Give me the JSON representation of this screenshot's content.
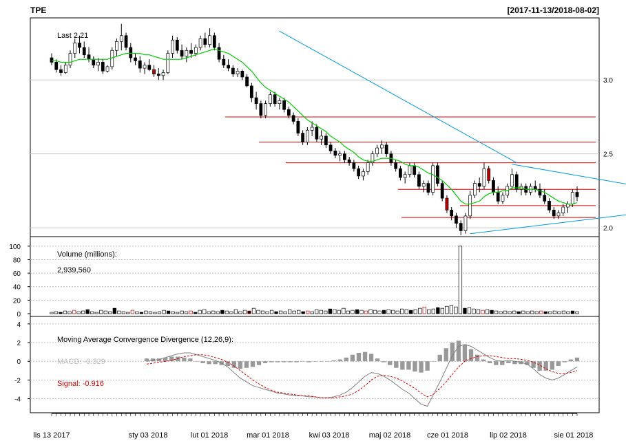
{
  "header": {
    "symbol": "TPE",
    "date_range": "[2017-11-13/2018-08-02]"
  },
  "chart_data": [
    {
      "type": "candlestick",
      "panel": "price",
      "label": "Last 2.21",
      "y_ticks": [
        "3.0",
        "2.5",
        "2.0"
      ],
      "ylim": [
        1.94,
        3.42
      ],
      "grid": true,
      "ohlc": [
        [
          3.15,
          3.18,
          3.1,
          3.12
        ],
        [
          3.12,
          3.14,
          3.05,
          3.07
        ],
        [
          3.07,
          3.1,
          3.03,
          3.05
        ],
        [
          3.05,
          3.12,
          3.04,
          3.1
        ],
        [
          3.1,
          3.2,
          3.08,
          3.18
        ],
        [
          3.18,
          3.28,
          3.15,
          3.25
        ],
        [
          3.25,
          3.3,
          3.18,
          3.22
        ],
        [
          3.22,
          3.26,
          3.15,
          3.17
        ],
        [
          3.17,
          3.22,
          3.12,
          3.14
        ],
        [
          3.14,
          3.16,
          3.08,
          3.1
        ],
        [
          3.1,
          3.15,
          3.06,
          3.12
        ],
        [
          3.12,
          3.14,
          3.04,
          3.06
        ],
        [
          3.06,
          3.1,
          3.05,
          3.09
        ],
        [
          3.09,
          3.22,
          3.07,
          3.2
        ],
        [
          3.2,
          3.28,
          3.16,
          3.26
        ],
        [
          3.26,
          3.38,
          3.2,
          3.3
        ],
        [
          3.3,
          3.32,
          3.2,
          3.22
        ],
        [
          3.22,
          3.25,
          3.12,
          3.15
        ],
        [
          3.15,
          3.18,
          3.1,
          3.13
        ],
        [
          3.13,
          3.16,
          3.05,
          3.08
        ],
        [
          3.08,
          3.12,
          3.04,
          3.1
        ],
        [
          3.1,
          3.14,
          3.06,
          3.07
        ],
        [
          3.07,
          3.1,
          3.02,
          3.04
        ],
        [
          3.04,
          3.08,
          3.0,
          3.03
        ],
        [
          3.03,
          3.07,
          3.0,
          3.05
        ],
        [
          3.05,
          3.2,
          3.04,
          3.18
        ],
        [
          3.18,
          3.3,
          3.15,
          3.27
        ],
        [
          3.27,
          3.29,
          3.18,
          3.2
        ],
        [
          3.2,
          3.24,
          3.14,
          3.16
        ],
        [
          3.16,
          3.22,
          3.12,
          3.2
        ],
        [
          3.2,
          3.25,
          3.15,
          3.18
        ],
        [
          3.18,
          3.24,
          3.16,
          3.22
        ],
        [
          3.22,
          3.3,
          3.2,
          3.28
        ],
        [
          3.28,
          3.32,
          3.22,
          3.24
        ],
        [
          3.24,
          3.35,
          3.22,
          3.3
        ],
        [
          3.3,
          3.32,
          3.2,
          3.22
        ],
        [
          3.22,
          3.25,
          3.12,
          3.14
        ],
        [
          3.14,
          3.17,
          3.08,
          3.1
        ],
        [
          3.1,
          3.14,
          3.06,
          3.08
        ],
        [
          3.08,
          3.1,
          3.02,
          3.04
        ],
        [
          3.04,
          3.08,
          3.02,
          3.06
        ],
        [
          3.06,
          3.07,
          3.0,
          3.02
        ],
        [
          3.02,
          3.04,
          2.95,
          2.96
        ],
        [
          2.96,
          2.98,
          2.85,
          2.88
        ],
        [
          2.88,
          2.92,
          2.8,
          2.84
        ],
        [
          2.84,
          2.86,
          2.74,
          2.76
        ],
        [
          2.76,
          2.86,
          2.74,
          2.84
        ],
        [
          2.84,
          2.92,
          2.82,
          2.9
        ],
        [
          2.9,
          2.92,
          2.82,
          2.84
        ],
        [
          2.84,
          2.88,
          2.8,
          2.86
        ],
        [
          2.86,
          2.88,
          2.78,
          2.8
        ],
        [
          2.8,
          2.82,
          2.74,
          2.76
        ],
        [
          2.76,
          2.78,
          2.7,
          2.72
        ],
        [
          2.72,
          2.74,
          2.62,
          2.64
        ],
        [
          2.64,
          2.66,
          2.56,
          2.58
        ],
        [
          2.58,
          2.68,
          2.56,
          2.66
        ],
        [
          2.66,
          2.72,
          2.62,
          2.68
        ],
        [
          2.68,
          2.7,
          2.58,
          2.6
        ],
        [
          2.6,
          2.66,
          2.56,
          2.62
        ],
        [
          2.62,
          2.64,
          2.54,
          2.56
        ],
        [
          2.56,
          2.58,
          2.5,
          2.52
        ],
        [
          2.52,
          2.54,
          2.47,
          2.49
        ],
        [
          2.49,
          2.52,
          2.45,
          2.5
        ],
        [
          2.5,
          2.52,
          2.44,
          2.46
        ],
        [
          2.46,
          2.48,
          2.42,
          2.44
        ],
        [
          2.44,
          2.46,
          2.38,
          2.4
        ],
        [
          2.4,
          2.42,
          2.33,
          2.35
        ],
        [
          2.35,
          2.4,
          2.32,
          2.38
        ],
        [
          2.38,
          2.46,
          2.36,
          2.44
        ],
        [
          2.44,
          2.52,
          2.42,
          2.5
        ],
        [
          2.5,
          2.56,
          2.48,
          2.54
        ],
        [
          2.54,
          2.59,
          2.5,
          2.56
        ],
        [
          2.56,
          2.58,
          2.48,
          2.5
        ],
        [
          2.5,
          2.52,
          2.42,
          2.44
        ],
        [
          2.44,
          2.46,
          2.38,
          2.4
        ],
        [
          2.4,
          2.42,
          2.32,
          2.34
        ],
        [
          2.34,
          2.38,
          2.3,
          2.36
        ],
        [
          2.36,
          2.44,
          2.34,
          2.42
        ],
        [
          2.42,
          2.44,
          2.34,
          2.36
        ],
        [
          2.36,
          2.38,
          2.26,
          2.28
        ],
        [
          2.28,
          2.32,
          2.24,
          2.3
        ],
        [
          2.3,
          2.32,
          2.22,
          2.24
        ],
        [
          2.24,
          2.44,
          2.22,
          2.42
        ],
        [
          2.42,
          2.44,
          2.28,
          2.3
        ],
        [
          2.3,
          2.32,
          2.18,
          2.2
        ],
        [
          2.2,
          2.22,
          2.1,
          2.12
        ],
        [
          2.12,
          2.14,
          2.05,
          2.08
        ],
        [
          2.08,
          2.1,
          2.0,
          2.03
        ],
        [
          2.03,
          2.05,
          1.95,
          1.98
        ],
        [
          1.98,
          2.1,
          1.96,
          2.08
        ],
        [
          2.08,
          2.25,
          2.06,
          2.22
        ],
        [
          2.22,
          2.32,
          2.2,
          2.3
        ],
        [
          2.3,
          2.34,
          2.24,
          2.28
        ],
        [
          2.28,
          2.44,
          2.26,
          2.4
        ],
        [
          2.4,
          2.42,
          2.3,
          2.32
        ],
        [
          2.32,
          2.34,
          2.22,
          2.24
        ],
        [
          2.24,
          2.28,
          2.16,
          2.18
        ],
        [
          2.18,
          2.24,
          2.16,
          2.22
        ],
        [
          2.22,
          2.3,
          2.2,
          2.28
        ],
        [
          2.28,
          2.4,
          2.26,
          2.36
        ],
        [
          2.36,
          2.38,
          2.24,
          2.26
        ],
        [
          2.26,
          2.3,
          2.22,
          2.28
        ],
        [
          2.28,
          2.3,
          2.22,
          2.24
        ],
        [
          2.24,
          2.3,
          2.22,
          2.28
        ],
        [
          2.28,
          2.32,
          2.24,
          2.26
        ],
        [
          2.26,
          2.3,
          2.2,
          2.22
        ],
        [
          2.22,
          2.26,
          2.16,
          2.18
        ],
        [
          2.18,
          2.2,
          2.1,
          2.12
        ],
        [
          2.12,
          2.14,
          2.06,
          2.08
        ],
        [
          2.08,
          2.12,
          2.06,
          2.1
        ],
        [
          2.1,
          2.16,
          2.08,
          2.14
        ],
        [
          2.14,
          2.18,
          2.1,
          2.16
        ],
        [
          2.16,
          2.26,
          2.14,
          2.24
        ],
        [
          2.24,
          2.28,
          2.18,
          2.21
        ]
      ],
      "down_color": "#bb0000",
      "sma": [
        3.13,
        3.13,
        3.12,
        3.12,
        3.12,
        3.13,
        3.14,
        3.14,
        3.14,
        3.14,
        3.14,
        3.14,
        3.14,
        3.15,
        3.16,
        3.17,
        3.18,
        3.18,
        3.18,
        3.18,
        3.17,
        3.17,
        3.16,
        3.15,
        3.14,
        3.14,
        3.14,
        3.14,
        3.14,
        3.15,
        3.16,
        3.17,
        3.18,
        3.19,
        3.2,
        3.21,
        3.2,
        3.19,
        3.18,
        3.16,
        3.14,
        3.12,
        3.09,
        3.06,
        3.02,
        2.98,
        2.95,
        2.93,
        2.91,
        2.89,
        2.87,
        2.85,
        2.82,
        2.79,
        2.76,
        2.73,
        2.71,
        2.69,
        2.67,
        2.65,
        2.62,
        2.6,
        2.58,
        2.55,
        2.53,
        2.51,
        2.48,
        2.46,
        2.45,
        2.45,
        2.46,
        2.47,
        2.47,
        2.47,
        2.46,
        2.45,
        2.43,
        2.42,
        2.42,
        2.41,
        2.39,
        2.37,
        2.36,
        2.34,
        2.32,
        2.29,
        2.26,
        2.22,
        2.18,
        2.16,
        2.16,
        2.17,
        2.18,
        2.21,
        2.23,
        2.24,
        2.24,
        2.25,
        2.25,
        2.27,
        2.27,
        2.27,
        2.26,
        2.26,
        2.26,
        2.25,
        2.24,
        2.22,
        2.2,
        2.18,
        2.17,
        2.16,
        2.16,
        2.17
      ],
      "sma_color": "#00cc00",
      "red_levels": [
        2.75,
        2.58,
        2.44,
        2.26,
        2.15,
        2.07
      ],
      "trendlines": [
        {
          "x1": 49,
          "y1": 3.33,
          "x2": 100,
          "y2": 2.44
        },
        {
          "x1": 99,
          "y1": 2.43,
          "x2": 132,
          "y2": 2.25
        },
        {
          "x1": 90,
          "y1": 1.96,
          "x2": 132,
          "y2": 2.12
        }
      ],
      "trend_color": "#0099dd",
      "level_color": "#dd0000"
    },
    {
      "type": "bar",
      "panel": "volume",
      "label": "Volume (millions):",
      "value_text": "2,939,560",
      "y_ticks": [
        "100",
        "80",
        "60",
        "40",
        "20",
        "0"
      ],
      "ylim": [
        0,
        110
      ],
      "values": [
        2,
        3,
        2,
        4,
        3,
        5,
        3,
        4,
        6,
        3,
        2,
        5,
        4,
        3,
        8,
        4,
        3,
        2,
        5,
        3,
        2,
        4,
        3,
        2,
        3,
        5,
        4,
        3,
        2,
        4,
        3,
        4,
        2,
        5,
        6,
        3,
        4,
        3,
        5,
        4,
        3,
        6,
        3,
        5,
        4,
        8,
        5,
        4,
        3,
        5,
        3,
        4,
        3,
        6,
        4,
        5,
        3,
        4,
        3,
        6,
        5,
        4,
        7,
        6,
        5,
        8,
        4,
        5,
        6,
        5,
        4,
        6,
        5,
        4,
        5,
        6,
        5,
        4,
        7,
        6,
        5,
        6,
        8,
        10,
        6,
        7,
        9,
        8,
        11,
        12,
        10,
        100,
        8,
        9,
        7,
        6,
        5,
        6,
        5,
        4,
        3,
        4,
        3,
        4,
        3,
        4,
        3,
        4,
        3,
        4,
        3,
        3,
        4,
        3,
        4,
        3,
        4,
        3
      ]
    },
    {
      "type": "line",
      "panel": "macd",
      "label": "Moving Average Convergence Divergence (12,26,9):",
      "macd_text": "MACD: -0.329",
      "signal_text": "Signal: -0.916",
      "y_ticks": [
        "4",
        "2",
        "0",
        "-2",
        "-4"
      ],
      "ylim": [
        -5.5,
        4.8
      ],
      "macd": [
        0.0,
        0.1,
        0.2,
        0.4,
        0.6,
        0.8,
        0.9,
        0.9,
        0.7,
        0.5,
        0.3,
        0.1,
        -0.2,
        -0.6,
        -1.2,
        -1.8,
        -2.2,
        -2.6,
        -2.8,
        -3.0,
        -3.2,
        -3.4,
        -3.5,
        -3.6,
        -3.7,
        -3.7,
        -3.8,
        -3.8,
        -3.9,
        -3.9,
        -3.8,
        -3.6,
        -3.3,
        -2.8,
        -2.2,
        -1.6,
        -1.2,
        -1.3,
        -1.6,
        -2.0,
        -2.5,
        -3.0,
        -3.4,
        -4.0,
        -4.6,
        -4.8,
        -3.5,
        -2.2,
        -0.8,
        0.6,
        1.6,
        1.8,
        1.6,
        1.2,
        0.8,
        0.4,
        0.1,
        0.0,
        0.1,
        0.0,
        -0.1,
        -0.3,
        -0.8,
        -1.4,
        -1.8,
        -2.0,
        -1.8,
        -1.4,
        -1.0,
        -0.6
      ],
      "signal": [
        -0.3,
        -0.2,
        -0.1,
        0.0,
        0.1,
        0.3,
        0.5,
        0.6,
        0.7,
        0.7,
        0.6,
        0.4,
        0.2,
        -0.1,
        -0.5,
        -1.0,
        -1.5,
        -2.0,
        -2.4,
        -2.8,
        -3.1,
        -3.3,
        -3.4,
        -3.5,
        -3.6,
        -3.7,
        -3.7,
        -3.8,
        -3.9,
        -3.9,
        -3.9,
        -3.8,
        -3.7,
        -3.5,
        -3.1,
        -2.6,
        -2.0,
        -1.6,
        -1.5,
        -1.6,
        -1.8,
        -2.1,
        -2.5,
        -2.9,
        -3.4,
        -3.8,
        -3.5,
        -2.9,
        -2.2,
        -1.4,
        -0.6,
        0.0,
        0.3,
        0.5,
        0.6,
        0.6,
        0.5,
        0.4,
        0.3,
        0.3,
        0.2,
        0.1,
        -0.1,
        -0.4,
        -0.8,
        -1.1,
        -1.3,
        -1.3,
        -1.2,
        -1.0
      ],
      "histogram": [
        0.3,
        0.3,
        0.3,
        0.4,
        0.5,
        0.5,
        0.4,
        0.3,
        0.0,
        -0.2,
        -0.3,
        -0.3,
        -0.4,
        -0.5,
        -0.7,
        -0.8,
        -0.7,
        -0.6,
        -0.4,
        -0.2,
        -0.1,
        -0.1,
        -0.1,
        -0.1,
        -0.1,
        0.0,
        -0.1,
        0.0,
        0.0,
        0.0,
        0.1,
        0.2,
        0.4,
        0.7,
        0.9,
        1.0,
        0.8,
        0.3,
        -0.1,
        -0.4,
        -0.7,
        -0.9,
        -0.9,
        -1.1,
        -1.2,
        -1.0,
        0.0,
        0.7,
        1.4,
        2.0,
        2.2,
        1.8,
        1.3,
        0.7,
        0.2,
        -0.2,
        -0.4,
        -0.4,
        -0.2,
        -0.3,
        -0.3,
        -0.4,
        -0.7,
        -1.0,
        -1.0,
        -0.9,
        -0.5,
        -0.1,
        0.2,
        0.4
      ],
      "macd_color": "#7f7f7f",
      "signal_color": "#dd0000"
    }
  ],
  "x_labels": [
    "lis 13 2017",
    "sty 03 2018",
    "lut 01 2018",
    "mar 01 2018",
    "kwi 03 2018",
    "maj 02 2018",
    "cze 01 2018",
    "lip 02 2018",
    "sie 01 2018"
  ]
}
